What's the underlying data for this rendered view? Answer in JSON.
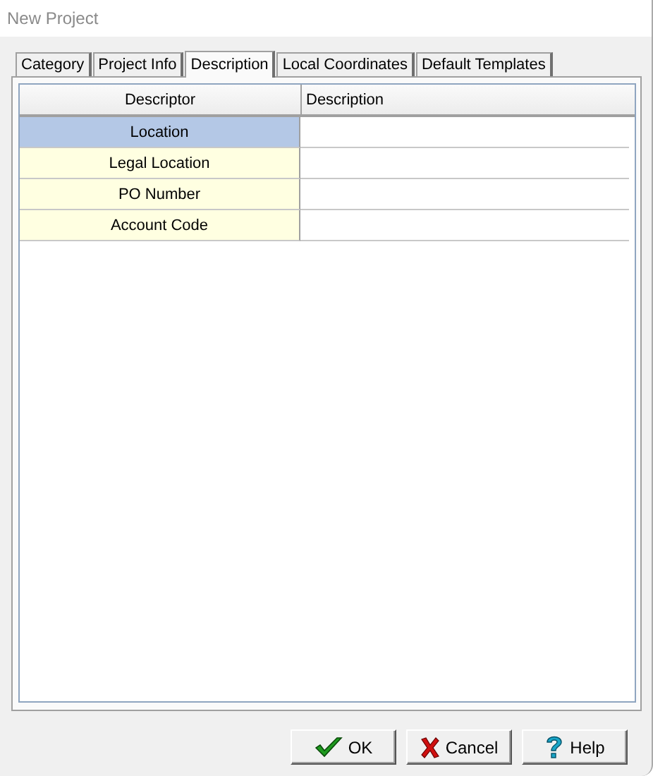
{
  "window": {
    "title": "New Project"
  },
  "tabs": [
    {
      "label": "Category",
      "selected": false
    },
    {
      "label": "Project Info",
      "selected": false
    },
    {
      "label": "Description",
      "selected": true
    },
    {
      "label": "Local Coordinates",
      "selected": false
    },
    {
      "label": "Default Templates",
      "selected": false
    }
  ],
  "table": {
    "columns": [
      "Descriptor",
      "Description"
    ],
    "rows": [
      {
        "descriptor": "Location",
        "selected": true
      },
      {
        "descriptor": "Legal Location",
        "selected": false
      },
      {
        "descriptor": "PO Number",
        "selected": false
      },
      {
        "descriptor": "Account Code",
        "selected": false
      }
    ]
  },
  "buttons": [
    {
      "kind": "ok",
      "label": "OK"
    },
    {
      "kind": "cancel",
      "label": "Cancel"
    },
    {
      "kind": "help",
      "label": "Help"
    }
  ]
}
